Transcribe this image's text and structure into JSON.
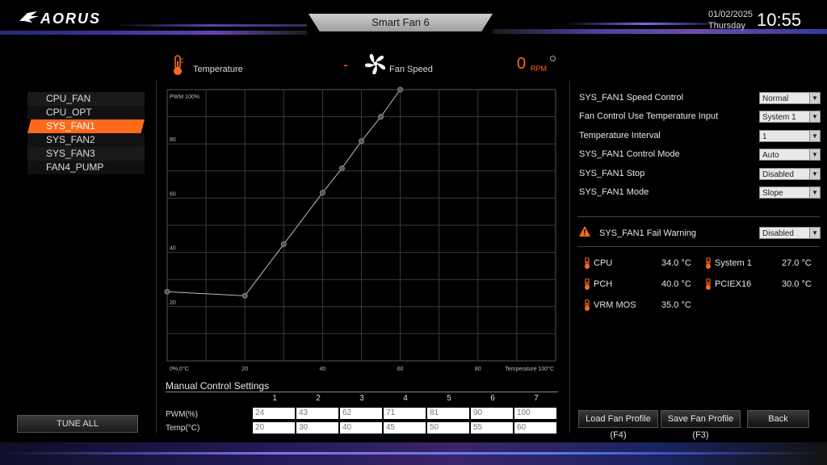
{
  "brand": {
    "logo_text": "AORUS"
  },
  "window": {
    "title": "Smart Fan 6"
  },
  "datetime": {
    "date": "01/02/2025",
    "day": "Thursday",
    "time": "10:55"
  },
  "header": {
    "temperature_label": "Temperature",
    "temperature_value": "-",
    "fan_speed_label": "Fan Speed",
    "rpm_value": "0",
    "rpm_unit": "RPM"
  },
  "fan_list": {
    "items": [
      "CPU_FAN",
      "CPU_OPT",
      "SYS_FAN1",
      "SYS_FAN2",
      "SYS_FAN3",
      "FAN4_PUMP"
    ],
    "selected": "SYS_FAN1"
  },
  "tune_all": {
    "label": "TUNE ALL"
  },
  "chart_data": {
    "type": "line",
    "ylabel": "PWM 100%",
    "xlabel": "Temperature 100°C",
    "origin_label": "0%,0°C",
    "x_ticks": [
      "20",
      "40",
      "60",
      "80"
    ],
    "y_ticks": [
      "20",
      "40",
      "60",
      "80"
    ],
    "xlim": [
      0,
      100
    ],
    "ylim": [
      0,
      100
    ],
    "grid": true,
    "points": [
      {
        "x": 0,
        "y": 25.5
      },
      {
        "x": 20,
        "y": 24
      },
      {
        "x": 30,
        "y": 43
      },
      {
        "x": 40,
        "y": 62
      },
      {
        "x": 45,
        "y": 71
      },
      {
        "x": 50,
        "y": 81
      },
      {
        "x": 55,
        "y": 90
      },
      {
        "x": 60,
        "y": 100
      }
    ]
  },
  "manual": {
    "title": "Manual Control Settings",
    "columns": [
      "1",
      "2",
      "3",
      "4",
      "5",
      "6",
      "7"
    ],
    "pwm_label": "PWM(%)",
    "temp_label": "Temp(°C)",
    "pwm": [
      "24",
      "43",
      "62",
      "71",
      "81",
      "90",
      "100"
    ],
    "temp": [
      "20",
      "30",
      "40",
      "45",
      "50",
      "55",
      "60"
    ]
  },
  "settings": [
    {
      "label": "SYS_FAN1 Speed Control",
      "value": "Normal"
    },
    {
      "label": "Fan Control Use Temperature Input",
      "value": "System 1"
    },
    {
      "label": "Temperature Interval",
      "value": "1"
    },
    {
      "label": "SYS_FAN1 Control Mode",
      "value": "Auto"
    },
    {
      "label": "SYS_FAN1 Stop",
      "value": "Disabled"
    },
    {
      "label": "SYS_FAN1 Mode",
      "value": "Slope"
    }
  ],
  "fail_warning": {
    "label": "SYS_FAN1 Fail Warning",
    "value": "Disabled"
  },
  "monitors": [
    {
      "name": "CPU",
      "value": "34.0 °C"
    },
    {
      "name": "System 1",
      "value": "27.0 °C"
    },
    {
      "name": "PCH",
      "value": "40.0 °C"
    },
    {
      "name": "PCIEX16",
      "value": "30.0 °C"
    },
    {
      "name": "VRM MOS",
      "value": "35.0 °C"
    }
  ],
  "buttons": {
    "load": "Load Fan Profile (F4)",
    "save": "Save Fan Profile (F3)",
    "back": "Back"
  },
  "colors": {
    "accent": "#ff6a1a"
  }
}
